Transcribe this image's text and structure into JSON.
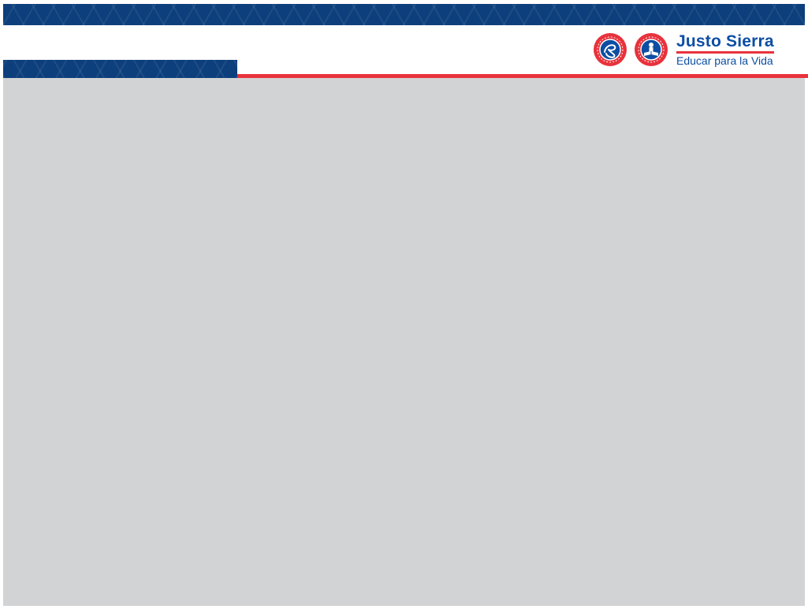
{
  "brand": {
    "name": "Justo Sierra",
    "tagline": "Educar para la Vida",
    "colors": {
      "primary_blue": "#0d3f7c",
      "text_blue": "#0d4ea3",
      "accent_red": "#e8323c",
      "content_grey": "#d2d3d5"
    }
  },
  "icons": [
    "seal-script-icon",
    "seal-book-icon"
  ]
}
